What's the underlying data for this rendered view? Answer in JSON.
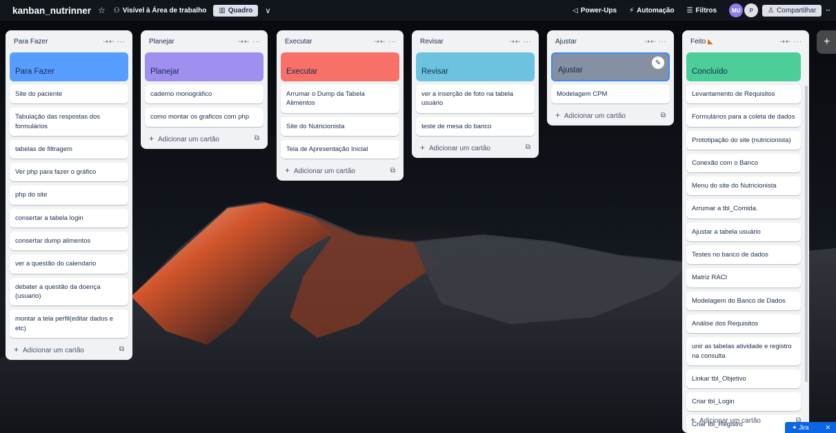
{
  "topbar": {
    "board_title": "kanban_nutrinner",
    "visibility_label": "Visível à Área de trabalho",
    "view_label": "Quadro",
    "power_ups": "Power-Ups",
    "automation": "Automação",
    "filters": "Filtros",
    "avatar1": "MU",
    "avatar2": "P",
    "share": "Compartilhar"
  },
  "lists": [
    {
      "title": "Para Fazer",
      "cover_label": "Para Fazer",
      "cover_color": "#579dff",
      "cards": [
        "Site do paciente",
        "Tabulação das respostas dos formulários",
        "tabelas de filtragem",
        "Ver php para fazer o gráfico",
        "php do site",
        "consertar a tabela login",
        "consertar dump alimentos",
        "ver a questão do calendario",
        "debater a questão da doença (usuario)",
        "montar a tela perfil(editar dados e etc)"
      ],
      "add_label": "Adicionar um cartão"
    },
    {
      "title": "Planejar",
      "cover_label": "Planejar",
      "cover_color": "#9f8fef",
      "cards": [
        "caderno monográfico",
        "como montar os graficos com php"
      ],
      "add_label": "Adicionar um cartão"
    },
    {
      "title": "Executar",
      "cover_label": "Executar",
      "cover_color": "#f87168",
      "cards": [
        "Arrumar o Dump da Tabela Alimentos",
        "Site do Nutricionista",
        "Tela de Apresentação Inicial"
      ],
      "add_label": "Adicionar um cartão"
    },
    {
      "title": "Revisar",
      "cover_label": "Revisar",
      "cover_color": "#6cc3e0",
      "cards": [
        "ver a inserção de foto na tabela usuário",
        "teste de mesa do banco"
      ],
      "add_label": "Adicionar um cartão"
    },
    {
      "title": "Ajustar",
      "cover_label": "Ajustar",
      "cover_color": "#8590a2",
      "cards": [
        "Modelagem CPM"
      ],
      "add_label": "Adicionar um cartão"
    },
    {
      "title": "Feito",
      "cover_label": "Concluído",
      "cover_color": "#4bce97",
      "cards": [
        "Levantamento de Requisitos",
        "Formulários para a coleta de dados",
        "Prototipação do site (nutricionista)",
        "Conexão com o Banco",
        "Menu do site do Nutricionista",
        "Arrumar a tbl_Comida.",
        "Ajustar a tabela usuário",
        "Testes no banco de dados",
        "Matriz RACI",
        "Modelagem do Banco de Dados",
        "Análise dos Requisitos",
        "unir as tabelas atividade e registro na consulta",
        "Linkar tbl_Objetivo",
        "Criar tbl_Login",
        "Criar tbl_Registro"
      ],
      "add_label": "Adicionar um cartão"
    }
  ],
  "jira_label": "Jira"
}
